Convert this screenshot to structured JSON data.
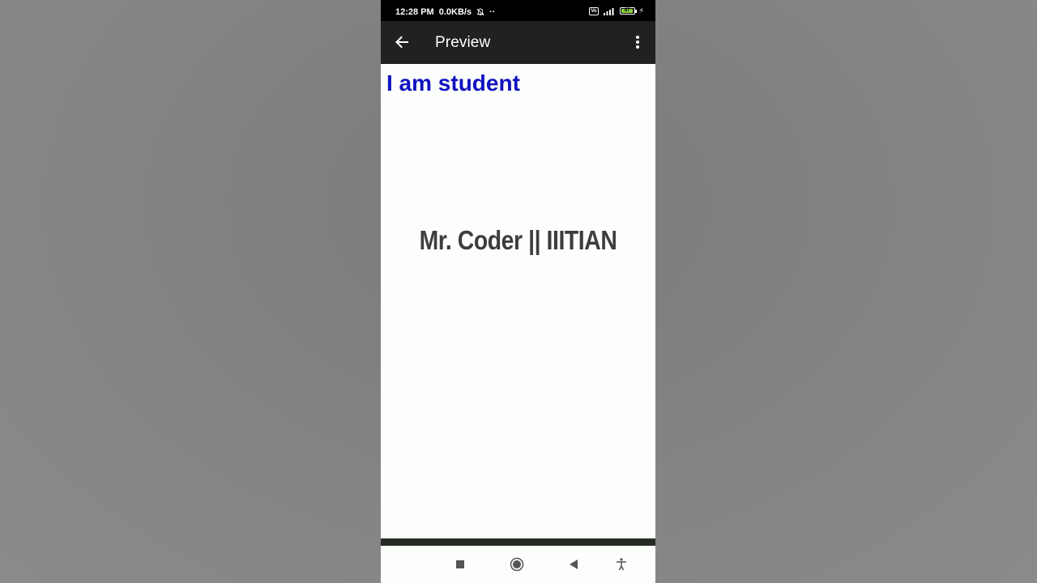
{
  "status_bar": {
    "time": "12:28 PM",
    "network_speed": "0.0KB/s",
    "dots": "··",
    "battery_level": "87",
    "vo_label": "Vo",
    "icons": [
      "bell-off-icon",
      "volte-icon",
      "signal-icon",
      "battery-icon",
      "charging-icon"
    ]
  },
  "app_bar": {
    "title": "Preview",
    "back_icon": "arrow-left-icon",
    "menu_icon": "more-vertical-icon"
  },
  "content": {
    "heading": "I am student",
    "center_title": "Mr. Coder || IIITIAN"
  },
  "nav_bar": {
    "icons": [
      "square-recents-icon",
      "circle-home-icon",
      "triangle-back-icon",
      "accessibility-icon"
    ]
  },
  "colors": {
    "heading": "#1212bf",
    "app_bar": "#1f221f",
    "content_bg": "#fbfefb",
    "center_text": "#3d3d3d",
    "battery": "#8bd13f"
  }
}
